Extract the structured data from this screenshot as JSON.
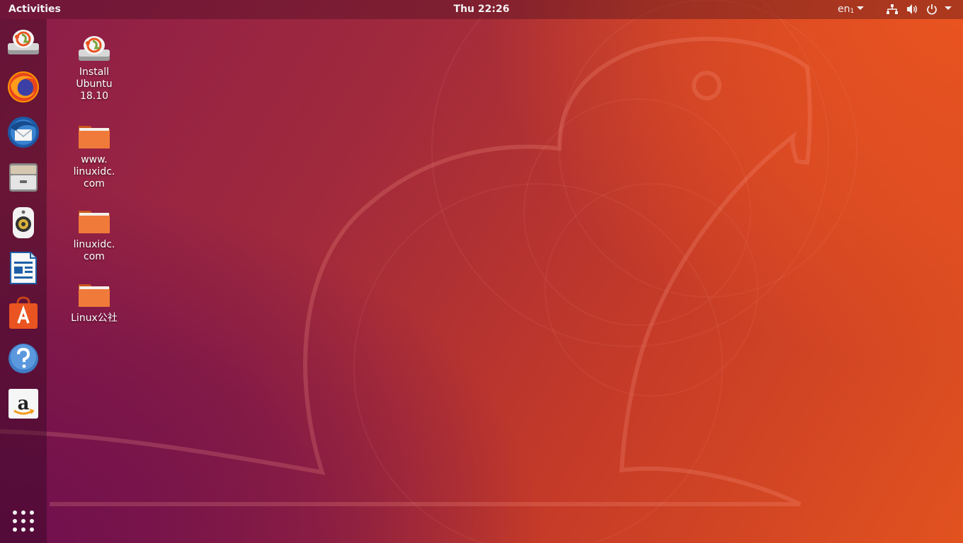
{
  "top_bar": {
    "activities_label": "Activities",
    "clock": "Thu 22:26",
    "language": "en",
    "language_sub": "1",
    "tray_icons": [
      "network-icon",
      "volume-icon",
      "power-icon"
    ]
  },
  "dock": {
    "items": [
      {
        "name": "install-ubuntu-icon"
      },
      {
        "name": "firefox-icon"
      },
      {
        "name": "thunderbird-icon"
      },
      {
        "name": "files-icon"
      },
      {
        "name": "rhythmbox-icon"
      },
      {
        "name": "libreoffice-writer-icon"
      },
      {
        "name": "ubuntu-software-icon"
      },
      {
        "name": "help-icon"
      },
      {
        "name": "amazon-icon"
      }
    ],
    "show_apps_icon": "app-grid-icon"
  },
  "desktop": {
    "icons": [
      {
        "label": "Install\nUbuntu\n18.10",
        "icon": "installer-icon"
      },
      {
        "label": "www.\nlinuxidc.\ncom",
        "icon": "folder-icon"
      },
      {
        "label": "linuxidc.\ncom",
        "icon": "folder-icon"
      },
      {
        "label": "Linux公社",
        "icon": "folder-icon"
      }
    ]
  },
  "colors": {
    "accent": "#e95420",
    "aubergine": "#77216f",
    "folder": "#f0793a"
  }
}
